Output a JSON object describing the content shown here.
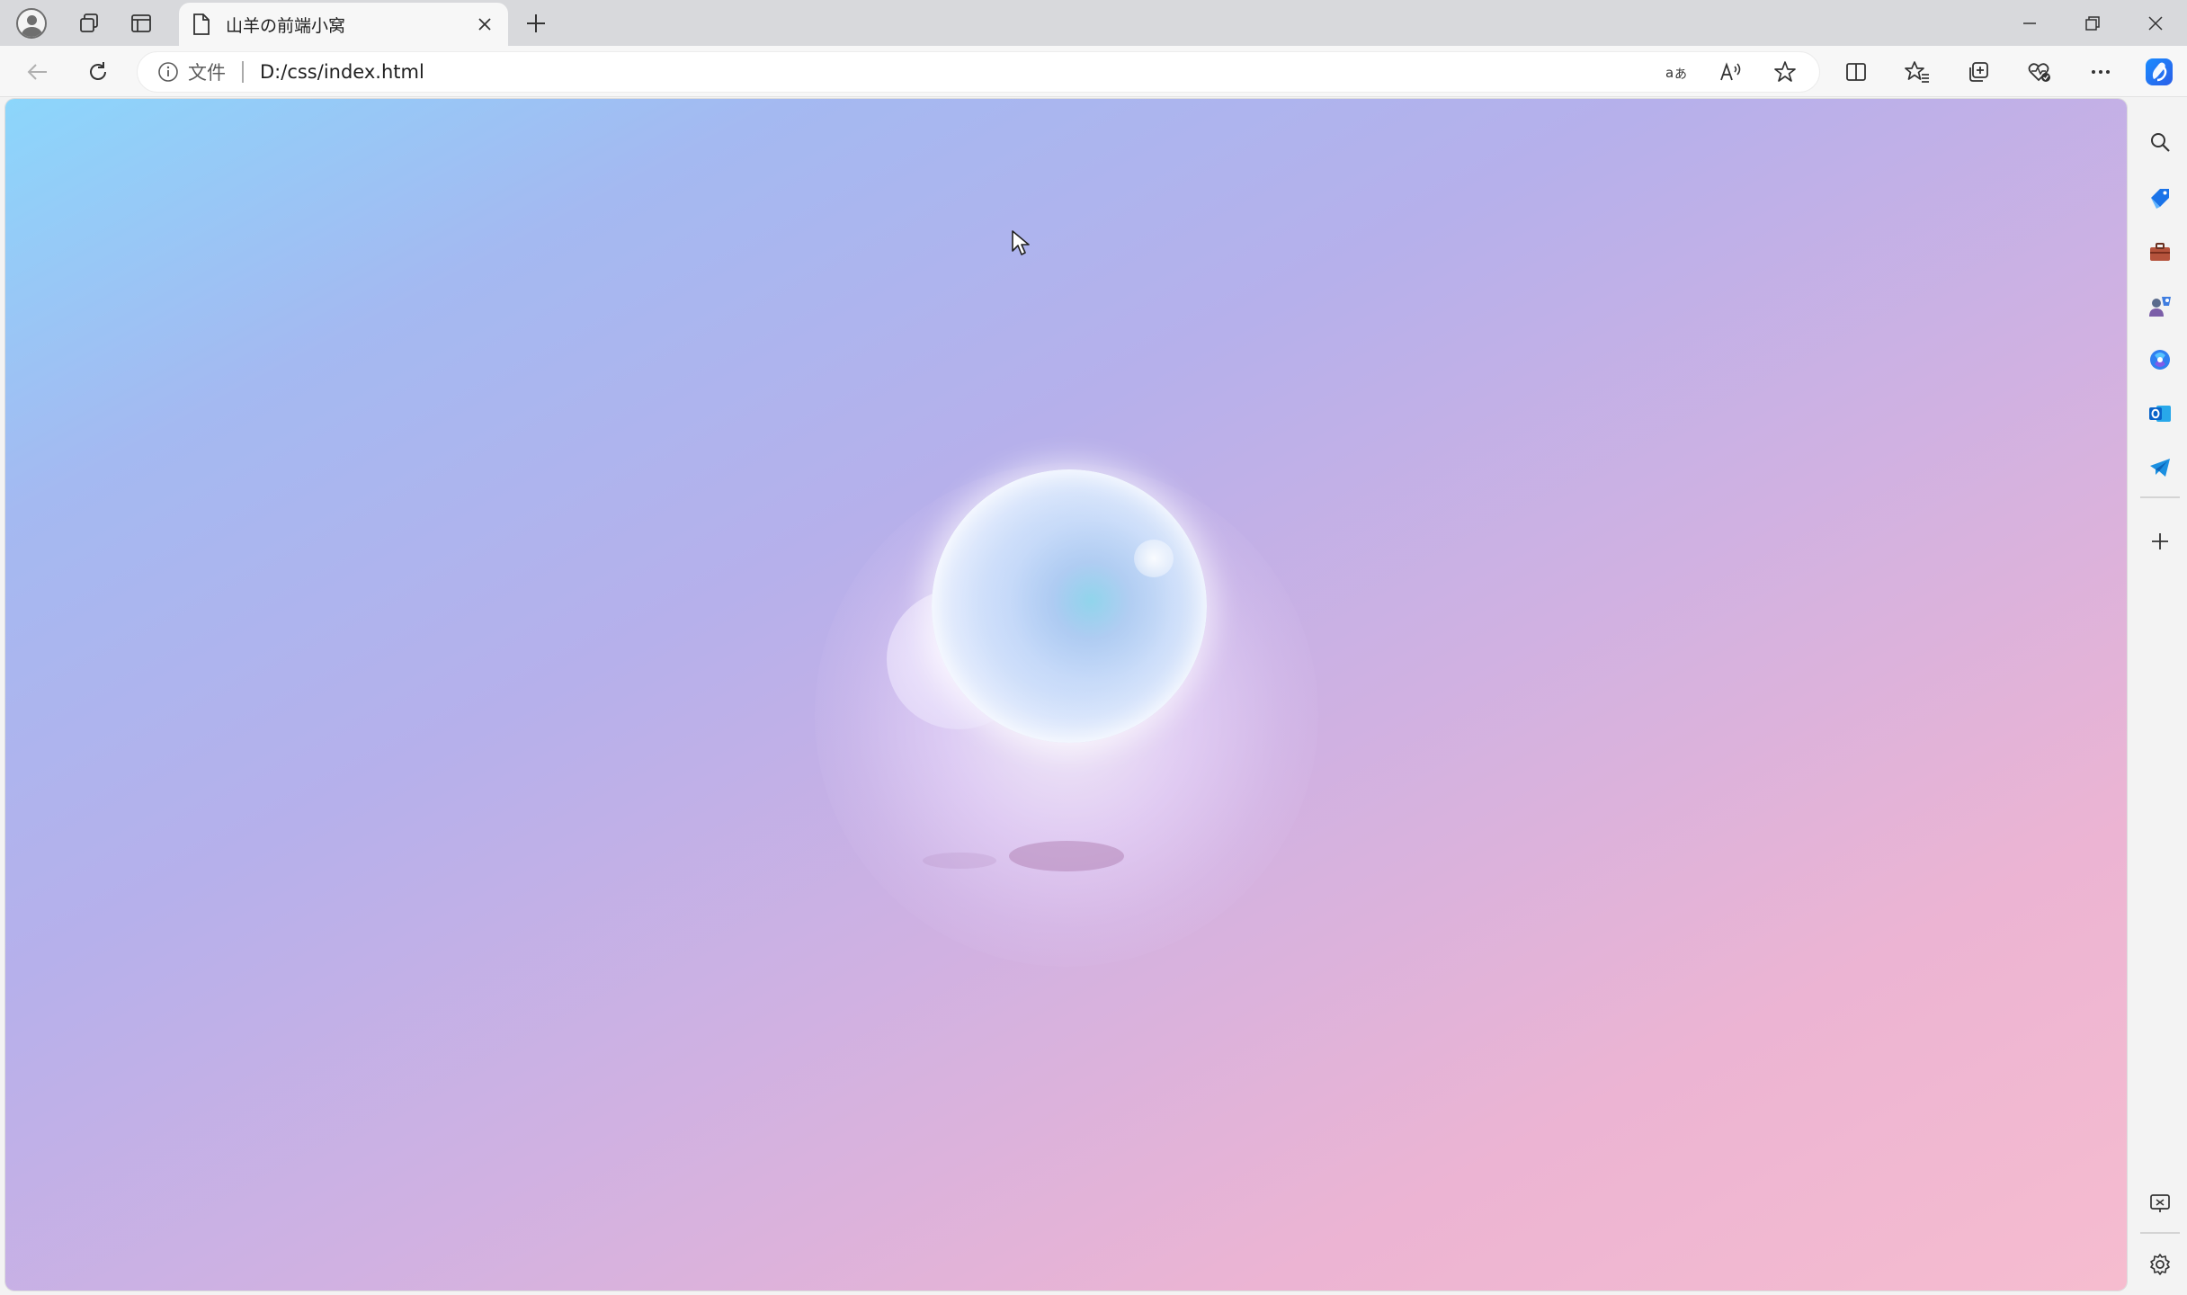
{
  "browser": {
    "tab": {
      "title": "山羊の前端小窝",
      "icon": "page-icon",
      "close_icon": "close-icon"
    },
    "new_tab_icon": "plus-icon",
    "address": {
      "info_label": "文件",
      "url": "D:/css/index.html"
    },
    "omnibox_actions": [
      "translate-icon",
      "read-aloud-icon",
      "favorite-star-icon"
    ],
    "toolbar_actions": [
      "split-screen-icon",
      "favorites-icon",
      "collections-icon",
      "browser-essentials-icon",
      "more-options-icon"
    ],
    "window_controls": [
      "minimize-icon",
      "restore-icon",
      "close-icon"
    ]
  },
  "sidebar": {
    "items": [
      "search-icon",
      "shopping-tag-icon",
      "tools-briefcase-icon",
      "games-icon",
      "microsoft-365-icon",
      "outlook-icon",
      "telegram-icon",
      "add-icon"
    ],
    "bottom": [
      "screenshot-icon",
      "settings-icon"
    ]
  },
  "colors": {
    "gradient_start": "#8cd6fb",
    "gradient_mid": "#c8b1e6",
    "gradient_end": "#f6bccf",
    "orb": "#d6e3fb",
    "accent": "#1a73e8"
  }
}
